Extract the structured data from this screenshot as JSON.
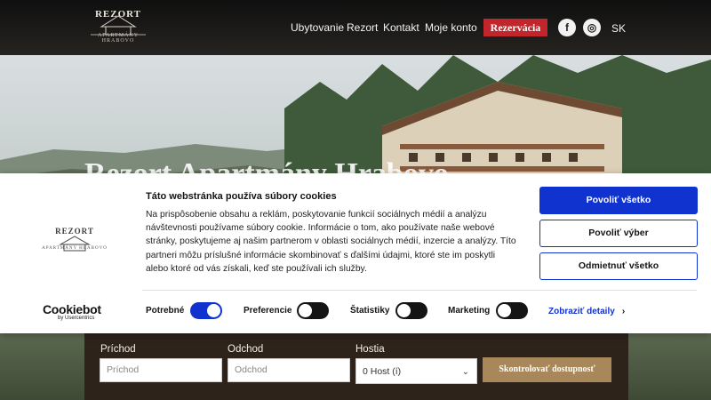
{
  "header": {
    "logo_brand": "REZORT",
    "logo_sub": "APARTMÁNY HRABOVO",
    "nav": [
      "Ubytovanie",
      "Rezort",
      "Kontakt",
      "Moje konto"
    ],
    "reservation_label": "Rezervácia",
    "facebook_icon": "f",
    "instagram_icon": "◎",
    "language": "SK"
  },
  "hero": {
    "title": "Rezort Apartmány Hrabovo"
  },
  "booking": {
    "arrival_label": "Príchod",
    "arrival_placeholder": "Príchod",
    "departure_label": "Odchod",
    "departure_placeholder": "Odchod",
    "guests_label": "Hostia",
    "guests_value": "0 Host (í)",
    "check_button": "Skontrolovať dostupnosť"
  },
  "cookie": {
    "logo_brand": "REZORT",
    "logo_sub": "APARTMÁNY HRABOVO",
    "title": "Táto webstránka používa súbory cookies",
    "body": "Na prispôsobenie obsahu a reklám, poskytovanie funkcií sociálnych médií a analýzu návštevnosti používame súbory cookie. Informácie o tom, ako používate naše webové stránky, poskytujeme aj našim partnerom v oblasti sociálnych médií, inzercie a analýzy. Títo partneri môžu príslušné informácie skombinovať s ďalšími údajmi, ktoré ste im poskytli alebo ktoré od vás získali, keď ste používali ich služby.",
    "allow_all": "Povoliť všetko",
    "allow_selection": "Povoliť výber",
    "deny_all": "Odmietnuť všetko",
    "cookiebot_brand": "Cookiebot",
    "cookiebot_sub": "by Usercentrics",
    "toggles": [
      {
        "label": "Potrebné",
        "on": true
      },
      {
        "label": "Preferencie",
        "on": false
      },
      {
        "label": "Štatistiky",
        "on": false
      },
      {
        "label": "Marketing",
        "on": false
      }
    ],
    "details_label": "Zobraziť detaily",
    "details_icon": "chevron-right-icon"
  },
  "colors": {
    "accent_blue": "#1032cf",
    "reservation_red": "#c0262c",
    "booking_bg": "#2e231b",
    "booking_button": "#a8875a"
  }
}
